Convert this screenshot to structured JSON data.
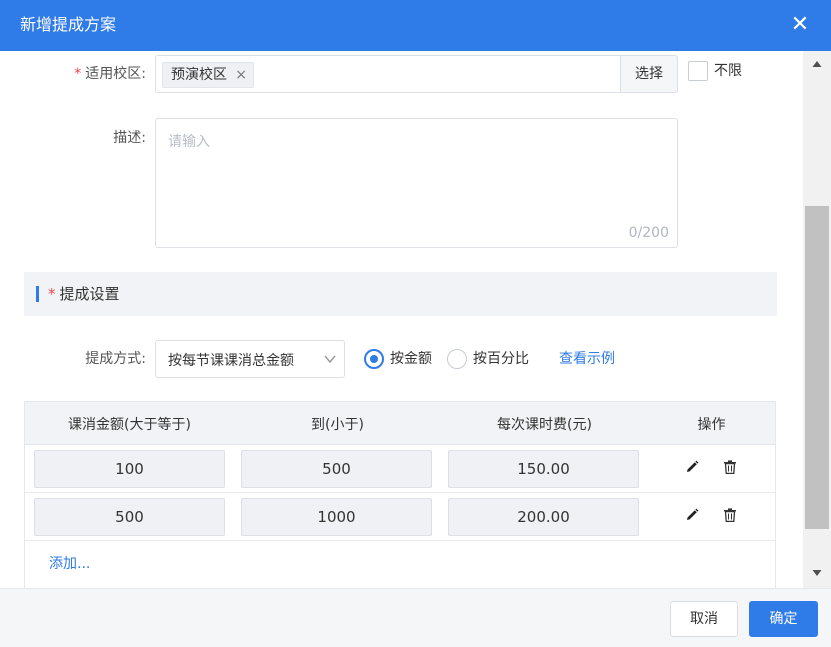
{
  "dialog": {
    "title": "新增提成方案",
    "close_icon": "✕"
  },
  "form": {
    "campus": {
      "label": "适用校区:",
      "required_mark": "*",
      "tag": "预演校区",
      "tag_remove_icon": "×",
      "select_button": "选择",
      "unlimited_label": "不限"
    },
    "description": {
      "label": "描述:",
      "placeholder": "请输入",
      "counter": "0/200"
    }
  },
  "section": {
    "required_mark": "*",
    "title": "提成设置"
  },
  "method": {
    "label": "提成方式:",
    "selected": "按每节课课消总金额",
    "dropdown_icon": "chevron-down",
    "radios": [
      {
        "label": "按金额",
        "checked": true
      },
      {
        "label": "按百分比",
        "checked": false
      }
    ],
    "example_link": "查看示例"
  },
  "table": {
    "headers": [
      "课消金额(大于等于)",
      "到(小于)",
      "每次课时费(元)",
      "操作"
    ],
    "rows": [
      {
        "from": "100",
        "to": "500",
        "fee": "150.00"
      },
      {
        "from": "500",
        "to": "1000",
        "fee": "200.00"
      }
    ],
    "add_link": "添加..."
  },
  "footer": {
    "cancel": "取消",
    "confirm": "确定"
  },
  "colors": {
    "primary": "#2f7be8",
    "required": "#e5484d"
  }
}
